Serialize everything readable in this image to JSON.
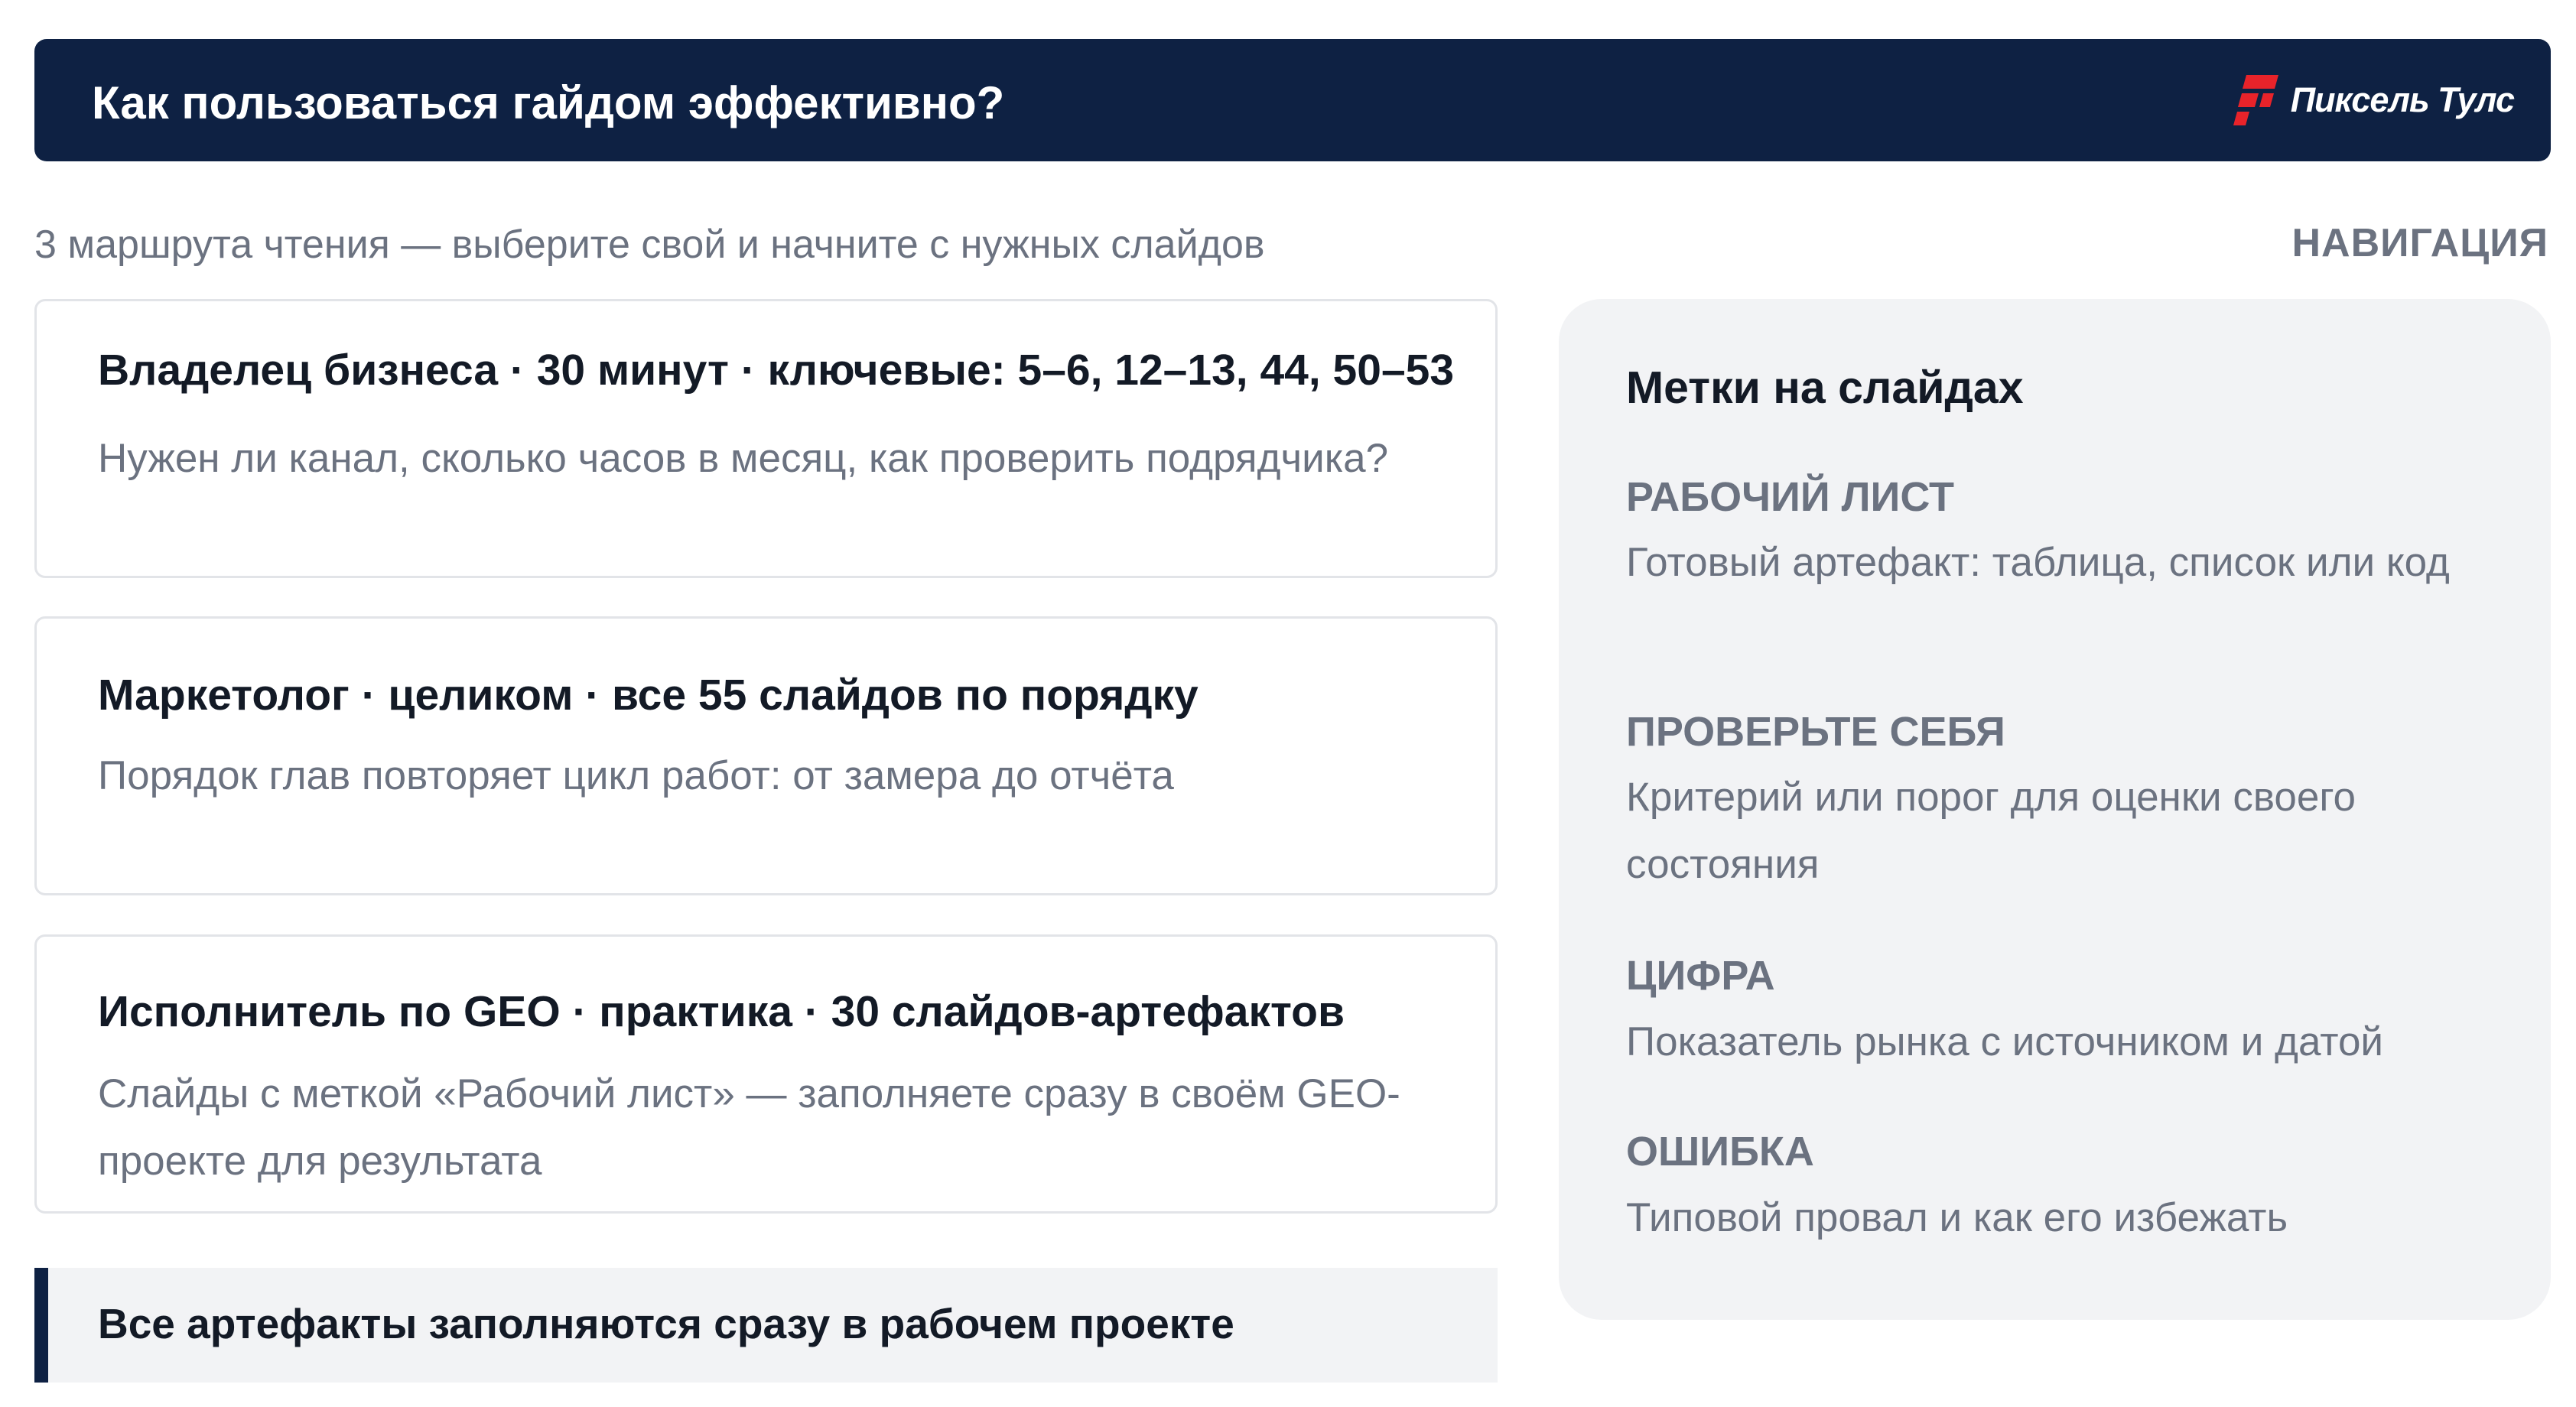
{
  "header": {
    "title": "Как пользоваться гайдом эффективно?",
    "logo_text": "Пиксель Тулс",
    "colors": {
      "background": "#0e2143",
      "logo_accent": "#e8232a"
    }
  },
  "subtitle": "3 маршрута чтения — выберите свой и начните с нужных слайдов",
  "nav_label": "НАВИГАЦИЯ",
  "routes": [
    {
      "title": "Владелец бизнеса · 30 минут · ключевые: 5–6, 12–13, 44, 50–53",
      "description": "Нужен ли канал, сколько часов в месяц, как проверить подрядчика?"
    },
    {
      "title": "Маркетолог · целиком · все 55 слайдов по порядку",
      "description": "Порядок глав повторяет цикл работ: от замера до отчёта"
    },
    {
      "title": "Исполнитель по GEO · практика · 30 слайдов-артефактов",
      "description": "Слайды с меткой «Рабочий лист» — заполняете сразу в своём GEO-проекте для результата"
    }
  ],
  "callout": {
    "text": "Все артефакты заполняются сразу в рабочем проекте"
  },
  "legend": {
    "title": "Метки на слайдах",
    "items": [
      {
        "label": "РАБОЧИЙ ЛИСТ",
        "description": "Готовый артефакт: таблица, список или код"
      },
      {
        "label": "ПРОВЕРЬТЕ СЕБЯ",
        "description": "Критерий или порог для оценки своего состояния"
      },
      {
        "label": "ЦИФРА",
        "description": "Показатель рынка с источником и датой"
      },
      {
        "label": "ОШИБКА",
        "description": "Типовой провал и как его избежать"
      }
    ]
  }
}
